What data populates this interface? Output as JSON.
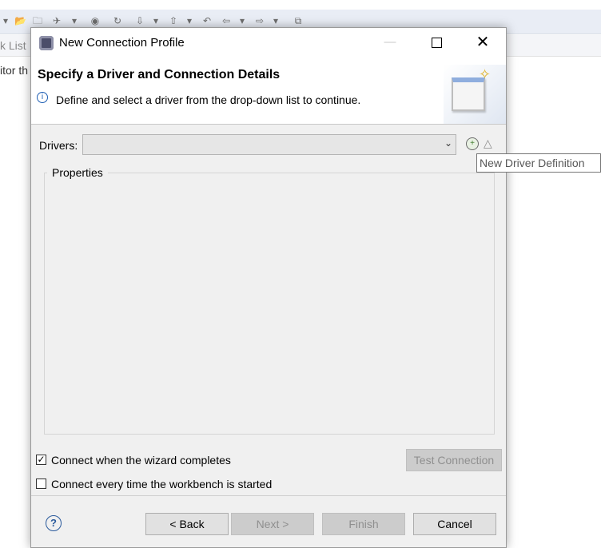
{
  "background": {
    "tab_label": "k List",
    "editor_text": "itor th",
    "toolbar_icons": [
      "dropdown-arrow-icon",
      "open-folder-icon",
      "folder-icon",
      "rocket-icon",
      "dropdown-arrow-icon",
      "globe-icon",
      "refresh-icon",
      "download-icon",
      "dropdown-arrow-icon",
      "upload-icon",
      "dropdown-arrow-icon",
      "back-history-icon",
      "left-arrow-icon",
      "dropdown-arrow-icon",
      "right-arrow-icon",
      "dropdown-arrow-icon",
      "external-icon"
    ]
  },
  "dialog": {
    "title": "New Connection Profile",
    "header_title": "Specify a Driver and Connection Details",
    "header_description": "Define and select a driver from the drop-down list to continue.",
    "drivers_label": "Drivers:",
    "drivers_value": "",
    "tooltip": "New Driver Definition",
    "properties_label": "Properties",
    "connect_when_complete_label": "Connect when the wizard completes",
    "connect_when_complete_checked": true,
    "connect_every_time_label": "Connect every time the workbench is started",
    "connect_every_time_checked": false,
    "test_connection_label": "Test Connection",
    "back_label": "< Back",
    "next_label": "Next >",
    "finish_label": "Finish",
    "cancel_label": "Cancel"
  },
  "colors": {
    "dialog_bg": "#f0f0f0",
    "banner_bg": "#ffffff",
    "disabled_text": "#8f8f8f",
    "info_blue": "#1f5fb4"
  }
}
